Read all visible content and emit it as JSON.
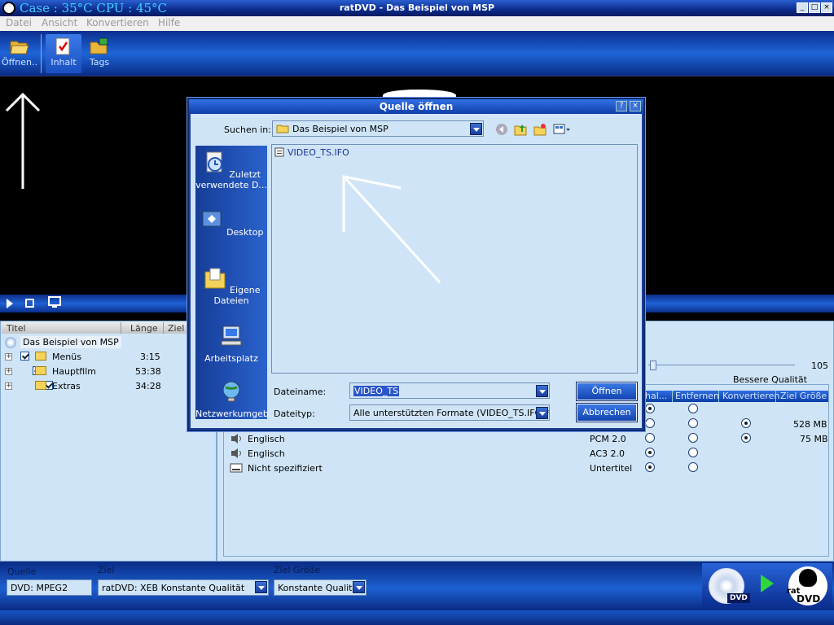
{
  "window": {
    "temp_text": "Case : 35°C  CPU : 45°C",
    "title": "ratDVD - Das Beispiel von MSP",
    "controls": [
      "_",
      "□",
      "×"
    ]
  },
  "menu": [
    "Datei",
    "Ansicht",
    "Konvertieren",
    "Hilfe"
  ],
  "toolbar": {
    "open_label": "Öffnen..",
    "content_label": "Inhalt",
    "tags_label": "Tags"
  },
  "left_panel": {
    "headers": [
      "Titel",
      "Länge",
      "Ziel G"
    ],
    "root": "Das Beispiel von MSP",
    "items": [
      {
        "name": "Menüs",
        "length": "3:15"
      },
      {
        "name": "Hauptfilm",
        "length": "53:38"
      },
      {
        "name": "Extras",
        "length": "34:28"
      }
    ]
  },
  "right_panel": {
    "slider_value": "105",
    "quality_label": "Bessere Qualität",
    "grid_headers": [
      "hal...",
      "Entfernen",
      "Konvertieren",
      "Ziel Größe"
    ],
    "rows": [
      {
        "name": "",
        "format": "",
        "keep": true,
        "remove": false,
        "convert": null,
        "size": ""
      },
      {
        "name": "",
        "format": "",
        "keep": false,
        "remove": false,
        "convert": true,
        "size": "528 MB"
      },
      {
        "name": "Englisch",
        "format": "PCM 2.0",
        "keep": false,
        "remove": false,
        "convert": true,
        "size": "75 MB"
      },
      {
        "name": "Englisch",
        "format": "AC3 2.0",
        "keep": true,
        "remove": false,
        "convert": null,
        "size": ""
      },
      {
        "name": "Nicht spezifiziert",
        "format": "Untertitel",
        "keep": true,
        "remove": false,
        "convert": null,
        "size": ""
      }
    ]
  },
  "bottom": {
    "source_label": "Quelle",
    "source_value": "DVD: MPEG2",
    "target_label": "Ziel",
    "target_value": "ratDVD: XEB Konstante Qualität",
    "size_label": "Ziel Größe",
    "size_value": "Konstante Qualität",
    "dvd_badge": "DVD",
    "rat_logo_top": "rat",
    "rat_logo_bottom": "DVD"
  },
  "dialog": {
    "title": "Quelle öffnen",
    "help": "?",
    "close": "×",
    "look_in_label": "Suchen in:",
    "look_in_value": "Das Beispiel von MSP",
    "places": [
      "Zuletzt verwendete D...",
      "Desktop",
      "Eigene Dateien",
      "Arbeitsplatz",
      "Netzwerkumgeb..."
    ],
    "files": [
      "VIDEO_TS.IFO"
    ],
    "filename_label": "Dateiname:",
    "filename_value": "VIDEO_TS",
    "filetype_label": "Dateityp:",
    "filetype_value": "Alle unterstützten Formate (VIDEO_TS.IFO;*.rat",
    "open_button": "Öffnen",
    "cancel_button": "Abbrechen"
  }
}
